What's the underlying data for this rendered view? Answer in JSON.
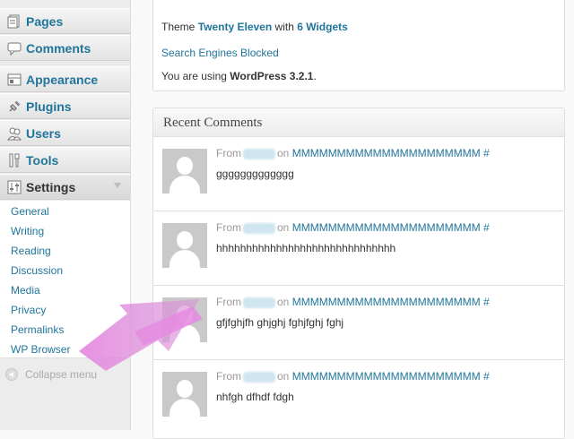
{
  "sidebar": {
    "menu": [
      {
        "label": "Pages",
        "icon": "pages-icon"
      },
      {
        "label": "Comments",
        "icon": "comments-icon"
      },
      {
        "label": "Appearance",
        "icon": "appearance-icon"
      },
      {
        "label": "Plugins",
        "icon": "plugins-icon"
      },
      {
        "label": "Users",
        "icon": "users-icon"
      },
      {
        "label": "Tools",
        "icon": "tools-icon"
      },
      {
        "label": "Settings",
        "icon": "settings-icon"
      }
    ],
    "submenu": [
      "General",
      "Writing",
      "Reading",
      "Discussion",
      "Media",
      "Privacy",
      "Permalinks",
      "WP Browser"
    ],
    "collapse_label": "Collapse menu"
  },
  "right_now": {
    "theme_prefix": "Theme",
    "theme_name": "Twenty Eleven",
    "with_text": "with",
    "widgets": "6 Widgets",
    "search_engines": "Search Engines Blocked",
    "using_prefix": "You are using",
    "wp_version": "WordPress 3.2.1",
    "using_suffix": "."
  },
  "recent_comments": {
    "title": "Recent Comments",
    "items": [
      {
        "from": "From",
        "on": "on",
        "post": "MMMMMMMMMMMMMMMMMMMMM #",
        "text": "ggggggggggggg"
      },
      {
        "from": "From",
        "on": "on",
        "post": "MMMMMMMMMMMMMMMMMMMMM #",
        "text": "hhhhhhhhhhhhhhhhhhhhhhhhhhhhhh"
      },
      {
        "from": "From",
        "on": "on",
        "post": "MMMMMMMMMMMMMMMMMMMMM #",
        "text": "gfjfghjfh ghjghj fghjfghj fghj"
      },
      {
        "from": "From",
        "on": "on",
        "post": "MMMMMMMMMMMMMMMMMMMMM #",
        "text": "nhfgh dfhdf fdgh"
      }
    ]
  },
  "colors": {
    "link": "#21759b",
    "annotation_arrow": "#e58be0"
  }
}
